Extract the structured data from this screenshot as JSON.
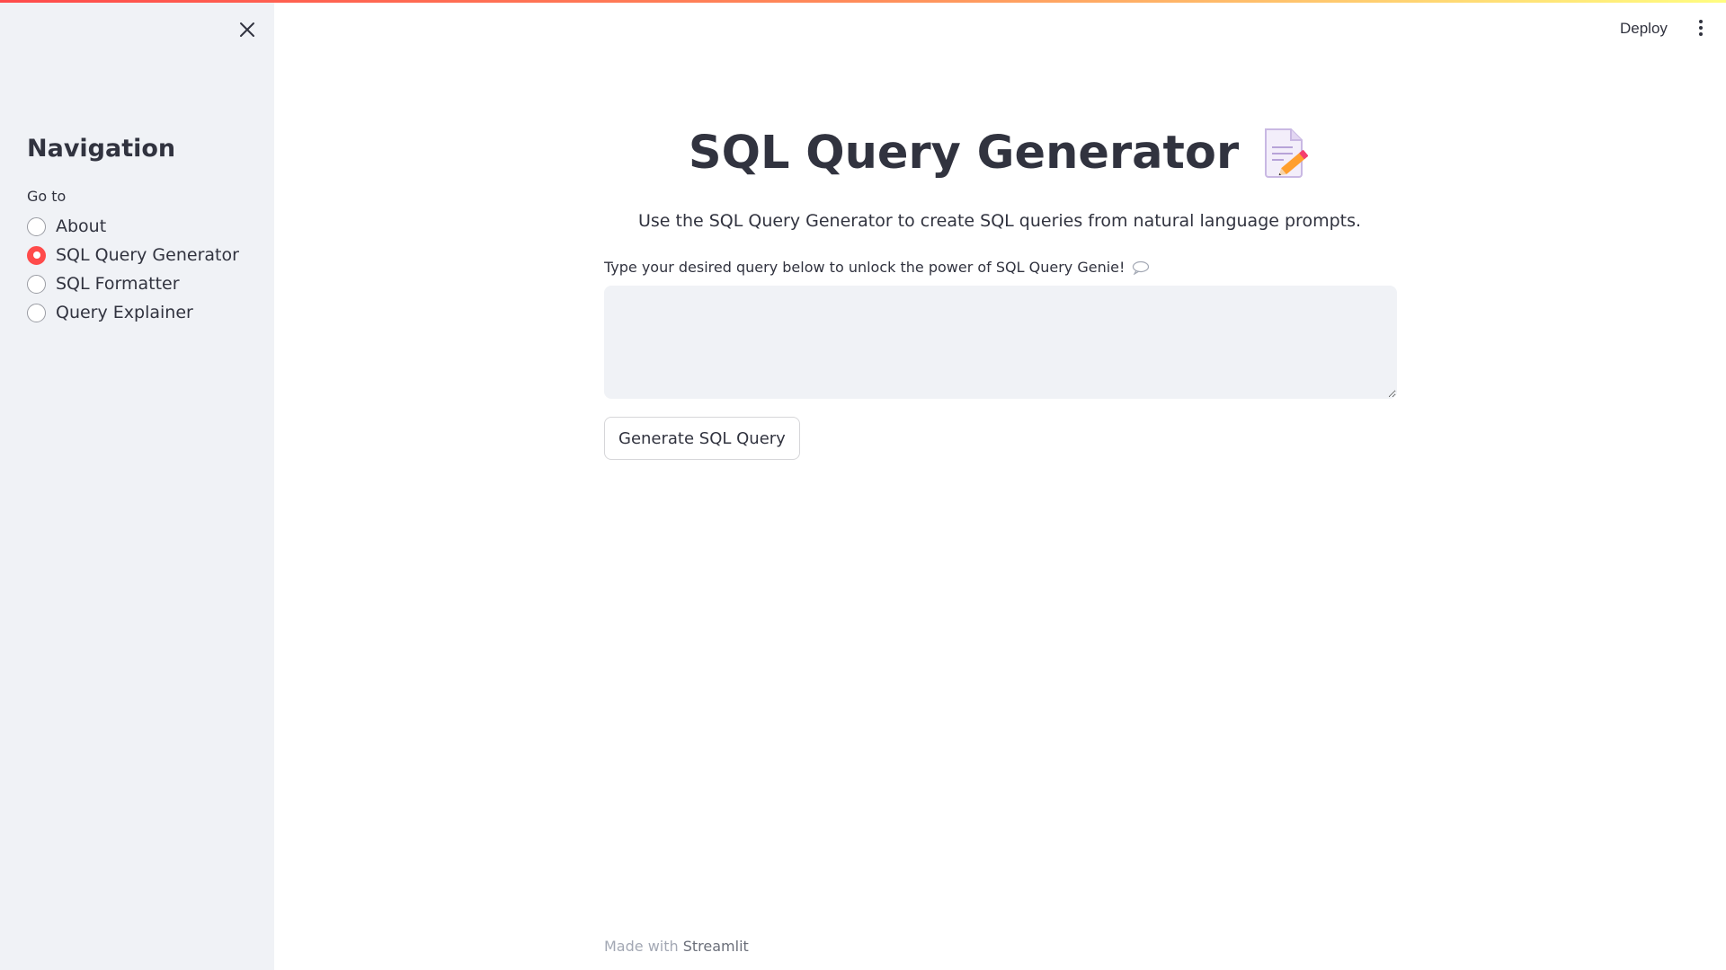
{
  "header": {
    "deploy_label": "Deploy",
    "menu_icon": "vertical-dots-icon",
    "accent_gradient": [
      "#ff4b4b",
      "#fffd80"
    ]
  },
  "sidebar": {
    "close_icon": "close-icon",
    "title": "Navigation",
    "radio_label": "Go to",
    "options": [
      {
        "label": "About",
        "selected": false
      },
      {
        "label": "SQL Query Generator",
        "selected": true
      },
      {
        "label": "SQL Formatter",
        "selected": false
      },
      {
        "label": "Query Explainer",
        "selected": false
      }
    ],
    "accent_color": "#ff4b4b"
  },
  "main": {
    "title": "SQL Query Generator",
    "title_icon": "memo-icon",
    "subtitle": "Use the SQL Query Generator to create SQL queries from natural language prompts.",
    "input_label": "Type your desired query below to unlock the power of SQL Query Genie!",
    "input_label_icon": "speech-bubble-icon",
    "textarea_value": "",
    "button_label": "Generate SQL Query"
  },
  "footer": {
    "prefix": "Made with",
    "link": "Streamlit"
  }
}
